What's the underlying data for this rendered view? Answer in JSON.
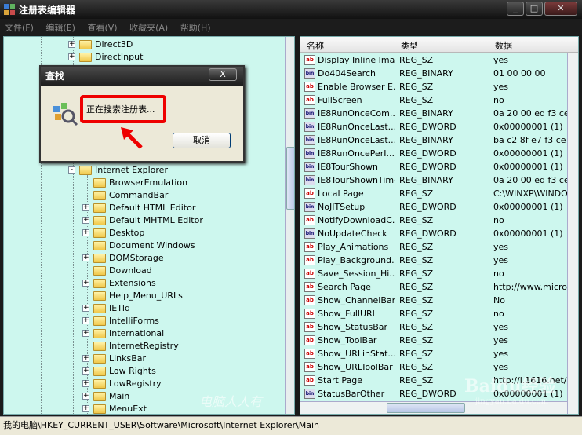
{
  "window": {
    "title": "注册表编辑器"
  },
  "menu": [
    "文件(F)",
    "编辑(E)",
    "查看(V)",
    "收藏夹(A)",
    "帮助(H)"
  ],
  "tree": [
    {
      "label": "Direct3D",
      "level": 1,
      "expander": "+"
    },
    {
      "label": "DirectInput",
      "level": 1,
      "expander": "+"
    },
    {
      "label": "Internet Explorer",
      "level": 1,
      "expander": "-"
    },
    {
      "label": "BrowserEmulation",
      "level": 2,
      "expander": ""
    },
    {
      "label": "CommandBar",
      "level": 2,
      "expander": ""
    },
    {
      "label": "Default HTML Editor",
      "level": 2,
      "expander": "+"
    },
    {
      "label": "Default MHTML Editor",
      "level": 2,
      "expander": "+"
    },
    {
      "label": "Desktop",
      "level": 2,
      "expander": "+"
    },
    {
      "label": "Document Windows",
      "level": 2,
      "expander": ""
    },
    {
      "label": "DOMStorage",
      "level": 2,
      "expander": "+"
    },
    {
      "label": "Download",
      "level": 2,
      "expander": ""
    },
    {
      "label": "Extensions",
      "level": 2,
      "expander": "+"
    },
    {
      "label": "Help_Menu_URLs",
      "level": 2,
      "expander": ""
    },
    {
      "label": "IETld",
      "level": 2,
      "expander": "+"
    },
    {
      "label": "IntelliForms",
      "level": 2,
      "expander": "+"
    },
    {
      "label": "International",
      "level": 2,
      "expander": "+"
    },
    {
      "label": "InternetRegistry",
      "level": 2,
      "expander": ""
    },
    {
      "label": "LinksBar",
      "level": 2,
      "expander": "+"
    },
    {
      "label": "Low Rights",
      "level": 2,
      "expander": "+"
    },
    {
      "label": "LowRegistry",
      "level": 2,
      "expander": "+"
    },
    {
      "label": "Main",
      "level": 2,
      "expander": "+"
    },
    {
      "label": "MenuExt",
      "level": 2,
      "expander": "+"
    }
  ],
  "list": {
    "headers": {
      "name": "名称",
      "type": "类型",
      "data": "数据"
    },
    "rows": [
      {
        "icon": "ab",
        "name": "Display Inline Ima...",
        "type": "REG_SZ",
        "data": "yes"
      },
      {
        "icon": "bin",
        "name": "Do404Search",
        "type": "REG_BINARY",
        "data": "01 00 00 00"
      },
      {
        "icon": "ab",
        "name": "Enable Browser E...",
        "type": "REG_SZ",
        "data": "yes"
      },
      {
        "icon": "ab",
        "name": "FullScreen",
        "type": "REG_SZ",
        "data": "no"
      },
      {
        "icon": "bin",
        "name": "IE8RunOnceCom...",
        "type": "REG_BINARY",
        "data": "0a 20 00 ed f3 ce c"
      },
      {
        "icon": "bin",
        "name": "IE8RunOnceLast...",
        "type": "REG_DWORD",
        "data": "0x00000001 (1)"
      },
      {
        "icon": "bin",
        "name": "IE8RunOnceLast...",
        "type": "REG_BINARY",
        "data": "ba c2 8f e7 f3 ce c"
      },
      {
        "icon": "bin",
        "name": "IE8RunOncePerI...",
        "type": "REG_DWORD",
        "data": "0x00000001 (1)"
      },
      {
        "icon": "bin",
        "name": "IE8TourShown",
        "type": "REG_DWORD",
        "data": "0x00000001 (1)"
      },
      {
        "icon": "bin",
        "name": "IE8TourShownTime",
        "type": "REG_BINARY",
        "data": "0a 20 00 ed f3 ce c"
      },
      {
        "icon": "ab",
        "name": "Local Page",
        "type": "REG_SZ",
        "data": "C:\\WINXP\\WINDOW"
      },
      {
        "icon": "bin",
        "name": "NoJITSetup",
        "type": "REG_DWORD",
        "data": "0x00000001 (1)"
      },
      {
        "icon": "ab",
        "name": "NotifyDownloadC...",
        "type": "REG_SZ",
        "data": "no"
      },
      {
        "icon": "bin",
        "name": "NoUpdateCheck",
        "type": "REG_DWORD",
        "data": "0x00000001 (1)"
      },
      {
        "icon": "ab",
        "name": "Play_Animations",
        "type": "REG_SZ",
        "data": "yes"
      },
      {
        "icon": "ab",
        "name": "Play_Background...",
        "type": "REG_SZ",
        "data": "yes"
      },
      {
        "icon": "ab",
        "name": "Save_Session_Hi...",
        "type": "REG_SZ",
        "data": "no"
      },
      {
        "icon": "ab",
        "name": "Search Page",
        "type": "REG_SZ",
        "data": "http://www.micros"
      },
      {
        "icon": "ab",
        "name": "Show_ChannelBand",
        "type": "REG_SZ",
        "data": "No"
      },
      {
        "icon": "ab",
        "name": "Show_FullURL",
        "type": "REG_SZ",
        "data": "no"
      },
      {
        "icon": "ab",
        "name": "Show_StatusBar",
        "type": "REG_SZ",
        "data": "yes"
      },
      {
        "icon": "ab",
        "name": "Show_ToolBar",
        "type": "REG_SZ",
        "data": "yes"
      },
      {
        "icon": "ab",
        "name": "Show_URLinStat...",
        "type": "REG_SZ",
        "data": "yes"
      },
      {
        "icon": "ab",
        "name": "Show_URLToolBar",
        "type": "REG_SZ",
        "data": "yes"
      },
      {
        "icon": "ab",
        "name": "Start Page",
        "type": "REG_SZ",
        "data": "http://i.1616.net/"
      },
      {
        "icon": "bin",
        "name": "StatusBarOther",
        "type": "REG_DWORD",
        "data": "0x00000001 (1)"
      }
    ]
  },
  "dialog": {
    "title": "查找",
    "close_label": "X",
    "message": "正在搜索注册表...",
    "cancel_label": "取消"
  },
  "status": {
    "path": "我的电脑\\HKEY_CURRENT_USER\\Software\\Microsoft\\Internet Explorer\\Main"
  },
  "watermark": {
    "text": "电脑人人有",
    "brand": "Baidu经验",
    "url": "jingyan.baidu.com"
  }
}
